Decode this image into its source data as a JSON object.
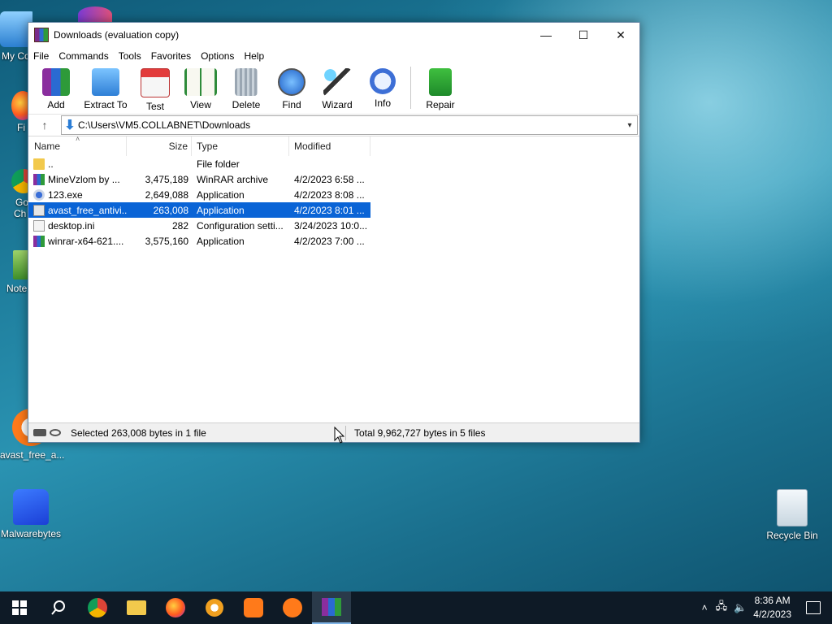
{
  "window": {
    "title": "Downloads (evaluation copy)",
    "minimize": "—",
    "maximize": "☐",
    "close": "✕"
  },
  "menu": [
    "File",
    "Commands",
    "Tools",
    "Favorites",
    "Options",
    "Help"
  ],
  "toolbar": [
    "Add",
    "Extract To",
    "Test",
    "View",
    "Delete",
    "Find",
    "Wizard",
    "Info",
    "Repair"
  ],
  "address": {
    "path": "C:\\Users\\VM5.COLLABNET\\Downloads"
  },
  "columns": {
    "name": "Name",
    "size": "Size",
    "type": "Type",
    "modified": "Modified"
  },
  "files": [
    {
      "name": "..",
      "size": "",
      "type": "File folder",
      "modified": ""
    },
    {
      "name": "MineVzlom by ...",
      "size": "3,475,189",
      "type": "WinRAR archive",
      "modified": "4/2/2023 6:58 ..."
    },
    {
      "name": "123.exe",
      "size": "2,649,088",
      "type": "Application",
      "modified": "4/2/2023 8:08 ..."
    },
    {
      "name": "avast_free_antivi...",
      "size": "263,008",
      "type": "Application",
      "modified": "4/2/2023 8:01 ..."
    },
    {
      "name": "desktop.ini",
      "size": "282",
      "type": "Configuration setti...",
      "modified": "3/24/2023 10:0..."
    },
    {
      "name": "winrar-x64-621....",
      "size": "3,575,160",
      "type": "Application",
      "modified": "4/2/2023 7:00 ..."
    }
  ],
  "status": {
    "selected": "Selected 263,008 bytes in 1 file",
    "total": "Total 9,962,727 bytes in 5 files"
  },
  "desktop": {
    "my_computer": "My Co",
    "firefox": "Fi",
    "chrome_line1": "Go",
    "chrome_line2": "Ch",
    "notepad": "Note",
    "avast": "avast_free_a...",
    "malwarebytes": "Malwarebytes",
    "recycle_bin": "Recycle Bin"
  },
  "clock": {
    "time": "8:36 AM",
    "date": "4/2/2023"
  },
  "colors": {
    "selection": "#0a64d6",
    "taskbar": "#0e1a26"
  }
}
